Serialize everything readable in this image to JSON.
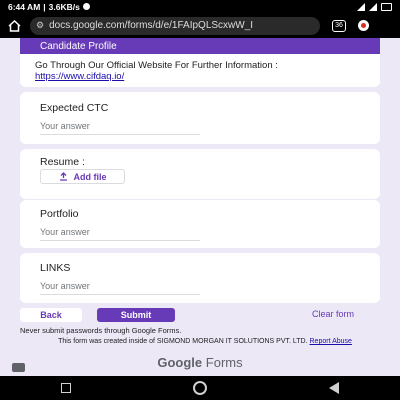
{
  "status_bar": {
    "time": "6:44 AM",
    "speed": "3.6KB/s"
  },
  "browser": {
    "url": "docs.google.com/forms/d/e/1FAIpQLScxwW_I",
    "tab_count": "36"
  },
  "header": {
    "section_title": "Candidate Profile",
    "text": "Go Through Our Official Website For Further Information :",
    "link": "https://www.cifdaq.io/"
  },
  "questions": [
    {
      "title": "Expected  CTC",
      "placeholder": "Your answer"
    },
    {
      "title": "Resume :",
      "button": "Add file"
    },
    {
      "title": "Portfolio",
      "placeholder": "Your answer"
    },
    {
      "title": "LINKS",
      "placeholder": "Your answer"
    }
  ],
  "actions": {
    "back": "Back",
    "submit": "Submit",
    "clear": "Clear form"
  },
  "footer": {
    "warning": "Never submit passwords through Google Forms.",
    "created": "This form was created inside of SIGMOND MORGAN IT SOLUTIONS PVT. LTD.",
    "report": "Report Abuse",
    "brand_google": "Google",
    "brand_forms": "Forms"
  },
  "colors": {
    "accent": "#673ab7",
    "background": "#ece8f6"
  }
}
